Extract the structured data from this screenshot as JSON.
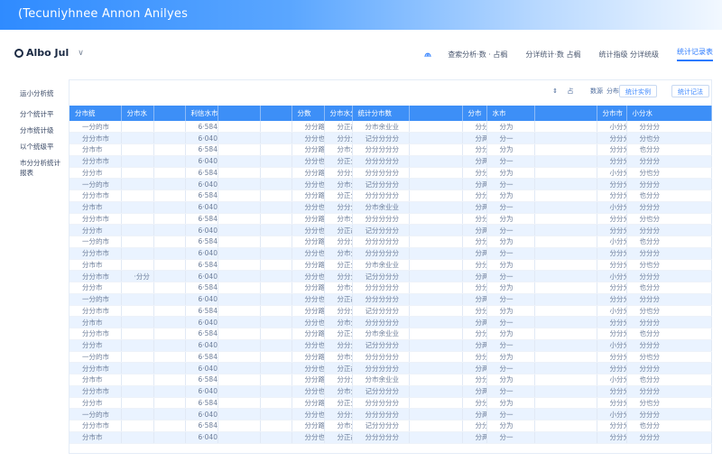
{
  "banner": {
    "title": "(Tecuniyhnee Annon Anilyes"
  },
  "brand": {
    "name": "Albo Jul",
    "caret": "∨"
  },
  "topnav": {
    "icon": "fingerprint-icon",
    "items": [
      "查索分析·数 · 占梮",
      "分详统计·数 占梮",
      "统计指级 分详统级",
      "统计记录表"
    ]
  },
  "sidebar": {
    "items": [
      "运小分析统",
      "分个统计平",
      "分市统计级",
      "以个统级平",
      "市分分析统计报表"
    ]
  },
  "toolbar": {
    "icon_sort": "sort-icon",
    "items": [
      "占",
      "数源",
      "分布",
      "统计实例",
      "统计记法"
    ]
  },
  "table": {
    "headers": [
      "分市统",
      "分市水",
      "",
      "利信水市",
      "",
      "",
      "分数",
      "分市水分水",
      "统计分市数",
      "",
      "分市",
      "水市",
      "",
      "分市市",
      "小分水"
    ],
    "rows": [
      [
        "一分的市",
        "",
        "",
        "6·584",
        "",
        "",
        "分分路",
        "分正故记记记",
        "分市余业业",
        "",
        "分分",
        "分为",
        "",
        "小分分",
        "分分分"
      ],
      [
        "分分市市",
        "",
        "",
        "6·040",
        "",
        "",
        "分分也",
        "分分分分分分",
        "记分分分分",
        "",
        "分两",
        "分一",
        "",
        "分分分",
        "分也分"
      ],
      [
        "分市市",
        "",
        "",
        "6·584",
        "",
        "",
        "分分路",
        "分市分分分分",
        "分分分分分",
        "",
        "分分",
        "分为",
        "",
        "分分分",
        "也分分"
      ],
      [
        "分分市市",
        "",
        "",
        "6·040",
        "",
        "",
        "分分也",
        "分正分记记记",
        "分分分分分",
        "",
        "分两",
        "分一",
        "",
        "分分分",
        "分分分"
      ],
      [
        "分分市",
        "",
        "",
        "6·584",
        "",
        "",
        "分分路",
        "分分分分分分",
        "分分分分分",
        "",
        "分分",
        "分为",
        "",
        "小分分",
        "分也分"
      ],
      [
        "一分的市",
        "",
        "",
        "6·040",
        "",
        "",
        "分分也",
        "分市分分分分",
        "记分分分分",
        "",
        "分两",
        "分一",
        "",
        "分分分",
        "分分分"
      ],
      [
        "分分市市",
        "",
        "",
        "6·584",
        "",
        "",
        "分分路",
        "分正分记记记",
        "分分分分分",
        "",
        "分分",
        "分为",
        "",
        "分分分",
        "也分分"
      ],
      [
        "分市市",
        "",
        "",
        "6·040",
        "",
        "",
        "分分也",
        "分分分分分分",
        "分市余业业",
        "",
        "分两",
        "分一",
        "",
        "小分分",
        "分分分"
      ],
      [
        "分分市市",
        "",
        "",
        "6·584",
        "",
        "",
        "分分路",
        "分市分分分分",
        "分分分分分",
        "",
        "分分",
        "分为",
        "",
        "分分分",
        "分也分"
      ],
      [
        "分分市",
        "",
        "",
        "6·040",
        "",
        "",
        "分分也",
        "分正故记记记",
        "记分分分分",
        "",
        "分两",
        "分一",
        "",
        "分分分",
        "分分分"
      ],
      [
        "一分的市",
        "",
        "",
        "6·584",
        "",
        "",
        "分分路",
        "分分分分分分",
        "分分分分分",
        "",
        "分分",
        "分为",
        "",
        "小分分",
        "也分分"
      ],
      [
        "分分市市",
        "",
        "",
        "6·040",
        "",
        "",
        "分分也",
        "分市分分分分",
        "分分分分分",
        "",
        "分两",
        "分一",
        "",
        "分分分",
        "分分分"
      ],
      [
        "分市市",
        "",
        "",
        "6·584",
        "",
        "",
        "分分路",
        "分正分记记记",
        "分市余业业",
        "",
        "分分",
        "分为",
        "",
        "分分分",
        "分也分"
      ],
      [
        "分分市市",
        "·分分",
        "",
        "6·040",
        "",
        "",
        "分分也",
        "分分分分分分",
        "记分分分分",
        "",
        "分两",
        "分一",
        "",
        "小分分",
        "分分分"
      ],
      [
        "分分市",
        "",
        "",
        "6·584",
        "",
        "",
        "分分路",
        "分市分分分分",
        "分分分分分",
        "",
        "分分",
        "分为",
        "",
        "分分分",
        "也分分"
      ],
      [
        "一分的市",
        "",
        "",
        "6·040",
        "",
        "",
        "分分也",
        "分正故记记记",
        "分分分分分",
        "",
        "分两",
        "分一",
        "",
        "分分分",
        "分分分"
      ],
      [
        "分分市市",
        "",
        "",
        "6·584",
        "",
        "",
        "分分路",
        "分分分分分分",
        "记分分分分",
        "",
        "分分",
        "分为",
        "",
        "小分分",
        "分也分"
      ],
      [
        "分市市",
        "",
        "",
        "6·040",
        "",
        "",
        "分分也",
        "分市分分分分",
        "分分分分分",
        "",
        "分两",
        "分一",
        "",
        "分分分",
        "分分分"
      ],
      [
        "分分市市",
        "",
        "",
        "6·584",
        "",
        "",
        "分分路",
        "分正分记记记",
        "分市余业业",
        "",
        "分分",
        "分为",
        "",
        "分分分",
        "也分分"
      ],
      [
        "分分市",
        "",
        "",
        "6·040",
        "",
        "",
        "分分也",
        "分分分分分分",
        "记分分分分",
        "",
        "分两",
        "分一",
        "",
        "小分分",
        "分分分"
      ],
      [
        "一分的市",
        "",
        "",
        "6·584",
        "",
        "",
        "分分路",
        "分市分分分分",
        "分分分分分",
        "",
        "分分",
        "分为",
        "",
        "分分分",
        "分也分"
      ],
      [
        "分分市市",
        "",
        "",
        "6·040",
        "",
        "",
        "分分也",
        "分正故记记记",
        "分分分分分",
        "",
        "分两",
        "分一",
        "",
        "分分分",
        "分分分"
      ],
      [
        "分市市",
        "",
        "",
        "6·584",
        "",
        "",
        "分分路",
        "分分分分分分",
        "分市余业业",
        "",
        "分分",
        "分为",
        "",
        "小分分",
        "也分分"
      ],
      [
        "分分市市",
        "",
        "",
        "6·040",
        "",
        "",
        "分分也",
        "分市分分分分",
        "记分分分分",
        "",
        "分两",
        "分一",
        "",
        "分分分",
        "分分分"
      ],
      [
        "分分市",
        "",
        "",
        "6·584",
        "",
        "",
        "分分路",
        "分正分记记记",
        "分分分分分",
        "",
        "分分",
        "分为",
        "",
        "分分分",
        "分也分"
      ],
      [
        "一分的市",
        "",
        "",
        "6·040",
        "",
        "",
        "分分也",
        "分分分分分分",
        "分分分分分",
        "",
        "分两",
        "分一",
        "",
        "小分分",
        "分分分"
      ],
      [
        "分分市市",
        "",
        "",
        "6·584",
        "",
        "",
        "分分路",
        "分市分分分分",
        "记分分分分",
        "",
        "分分",
        "分为",
        "",
        "分分分",
        "也分分"
      ],
      [
        "分市市",
        "",
        "",
        "6·040",
        "",
        "",
        "分分也",
        "分正故记记记",
        "分分分分分",
        "",
        "分两",
        "分一",
        "",
        "分分分",
        "分分分"
      ]
    ]
  },
  "colors": {
    "accent": "#2c7bff",
    "header_bg": "#3d8ff7",
    "row_alt": "#eaf3ff"
  }
}
